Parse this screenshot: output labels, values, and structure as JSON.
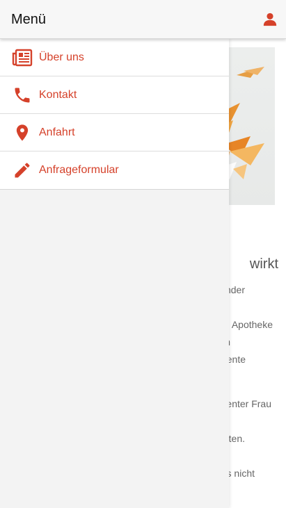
{
  "header": {
    "title": "Menü",
    "user_icon": "user-icon"
  },
  "menu": {
    "accent_color": "#d5412a",
    "items": [
      {
        "label": "Über uns",
        "icon": "newspaper-icon"
      },
      {
        "label": "Kontakt",
        "icon": "phone-icon"
      },
      {
        "label": "Anfahrt",
        "icon": "map-pin-icon"
      },
      {
        "label": "Anfrageformular",
        "icon": "pencil-icon"
      }
    ]
  },
  "background": {
    "heading": "wirkt",
    "lines": [
      "nder",
      "Apotheke",
      "n",
      "ente",
      "enter Frau",
      "ten.",
      "s nicht"
    ]
  }
}
